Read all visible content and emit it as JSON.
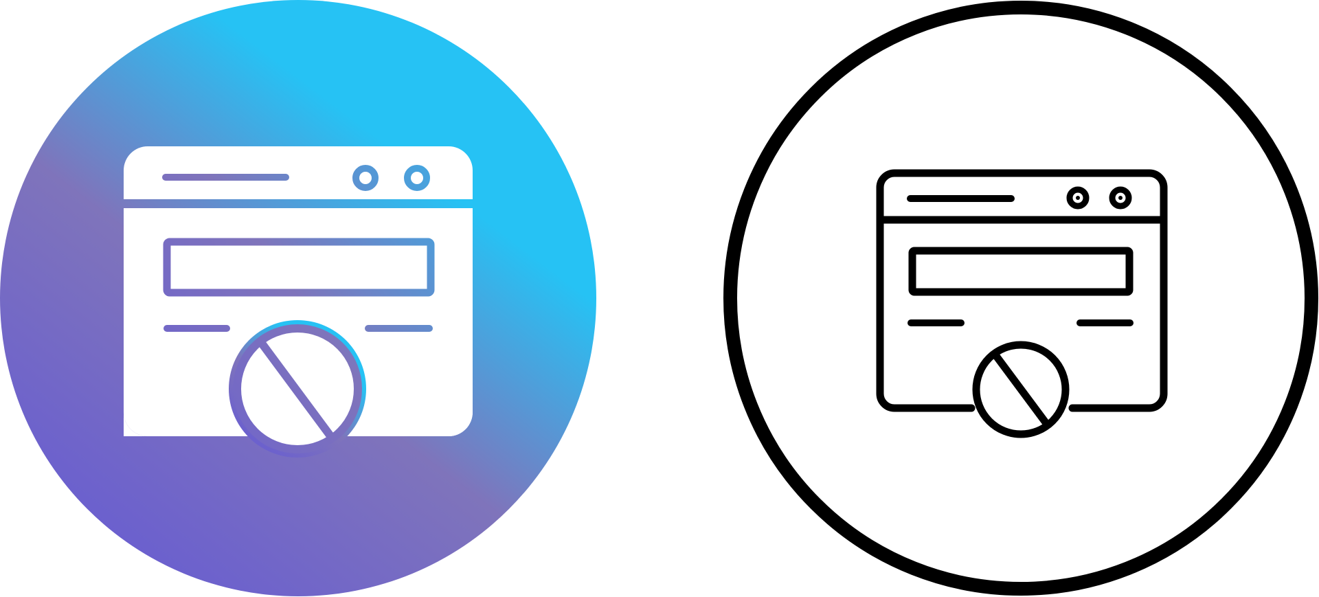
{
  "icons": [
    {
      "name": "blocked-browser-window-icon",
      "style": "gradient-glyph",
      "colors": {
        "gradient_from": "#6a5fcf",
        "gradient_mid": "#7f74bb",
        "gradient_to": "#26c2f4",
        "glyph": "#ffffff"
      }
    },
    {
      "name": "blocked-browser-window-icon",
      "style": "line-outline",
      "colors": {
        "stroke": "#000000",
        "background": "#ffffff"
      }
    }
  ]
}
